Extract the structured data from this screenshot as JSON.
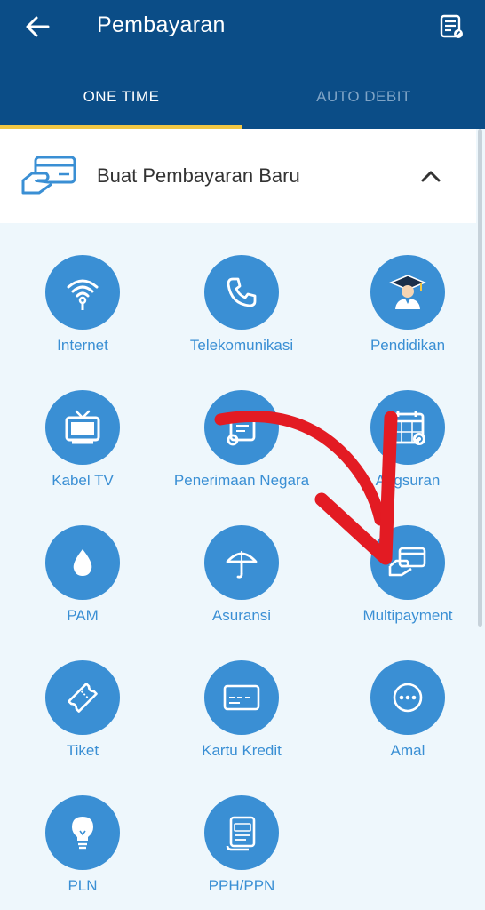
{
  "header": {
    "title": "Pembayaran",
    "back_icon": "arrow-left-icon",
    "history_icon": "transaction-list-icon",
    "background_color": "#0b4d87"
  },
  "tabs": [
    {
      "label": "ONE TIME",
      "active": true
    },
    {
      "label": "AUTO DEBIT",
      "active": false
    }
  ],
  "tab_indicator_color": "#f2c744",
  "section": {
    "title": "Buat Pembayaran Baru",
    "icon": "hand-card-icon",
    "expanded": true
  },
  "accent_color": "#3a8fd4",
  "items": [
    {
      "label": "Internet",
      "icon": "wifi-icon"
    },
    {
      "label": "Telekomunikasi",
      "icon": "phone-icon"
    },
    {
      "label": "Pendidikan",
      "icon": "graduate-icon"
    },
    {
      "label": "Kabel TV",
      "icon": "tv-icon"
    },
    {
      "label": "Penerimaan Negara",
      "icon": "scroll-icon"
    },
    {
      "label": "Angsuran",
      "icon": "calendar-icon"
    },
    {
      "label": "PAM",
      "icon": "water-drop-icon"
    },
    {
      "label": "Asuransi",
      "icon": "umbrella-icon"
    },
    {
      "label": "Multipayment",
      "icon": "hand-card-icon"
    },
    {
      "label": "Tiket",
      "icon": "ticket-icon"
    },
    {
      "label": "Kartu Kredit",
      "icon": "credit-card-icon"
    },
    {
      "label": "Amal",
      "icon": "more-dots-icon"
    },
    {
      "label": "PLN",
      "icon": "lightbulb-icon"
    },
    {
      "label": "PPH/PPN",
      "icon": "tax-document-icon"
    }
  ]
}
